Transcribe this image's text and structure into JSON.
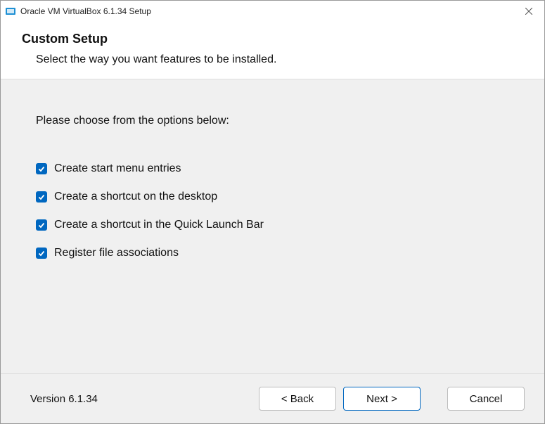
{
  "titlebar": {
    "title": "Oracle VM VirtualBox 6.1.34 Setup"
  },
  "header": {
    "title": "Custom Setup",
    "subtitle": "Select the way you want features to be installed."
  },
  "content": {
    "instruction": "Please choose from the options below:",
    "options": [
      {
        "label": "Create start menu entries",
        "checked": true
      },
      {
        "label": "Create a shortcut on the desktop",
        "checked": true
      },
      {
        "label": "Create a shortcut in the Quick Launch Bar",
        "checked": true
      },
      {
        "label": "Register file associations",
        "checked": true
      }
    ]
  },
  "footer": {
    "version": "Version 6.1.34",
    "back": "< Back",
    "next": "Next >",
    "cancel": "Cancel"
  }
}
